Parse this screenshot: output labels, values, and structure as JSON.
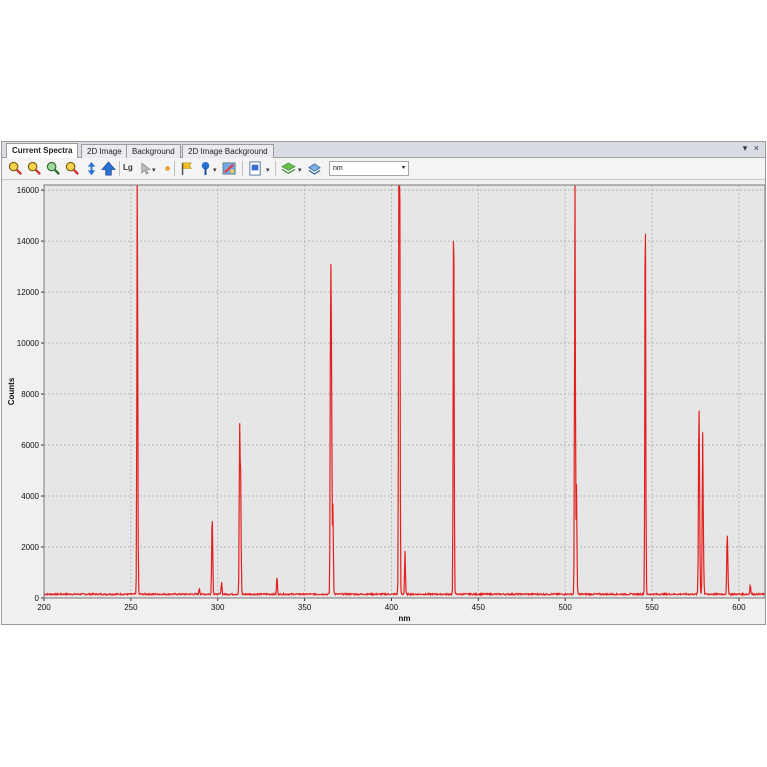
{
  "tabs": [
    {
      "label": "Current Spectra",
      "active": true
    },
    {
      "label": "2D Image",
      "active": false
    },
    {
      "label": "Background",
      "active": false
    },
    {
      "label": "2D Image Background",
      "active": false
    }
  ],
  "tab_menu": "▾ ×",
  "toolbar": {
    "log_label": "Lg",
    "unit_value": "nm",
    "icons": [
      "zoom-in-icon",
      "zoom-out-icon",
      "zoom-fit-icon",
      "zoom-reset-icon",
      "scale-vertical-icon",
      "arrow-up-icon",
      "cursor-icon",
      "dot-icon",
      "flag-icon",
      "pin-icon",
      "palette-icon",
      "save-icon",
      "layers-icon",
      "print-icon"
    ]
  },
  "colors": {
    "trace": "#e32020",
    "plot_bg": "#e6e6e6",
    "grid": "#b8b8b8"
  },
  "chart_data": {
    "type": "line",
    "xlabel": "nm",
    "ylabel": "Counts",
    "xlim": [
      200,
      615
    ],
    "ylim": [
      0,
      16200
    ],
    "x_ticks": [
      200,
      250,
      300,
      350,
      400,
      450,
      500,
      550,
      600
    ],
    "y_ticks": [
      0,
      2000,
      4000,
      6000,
      8000,
      10000,
      12000,
      14000,
      16000
    ],
    "grid": true,
    "series": [
      {
        "baseline": 150,
        "peaks": [
          {
            "x": 253.7,
            "y": 16200
          },
          {
            "x": 254.0,
            "y": 1100
          },
          {
            "x": 289.4,
            "y": 250
          },
          {
            "x": 296.7,
            "y": 2100
          },
          {
            "x": 297.0,
            "y": 1600
          },
          {
            "x": 302.2,
            "y": 500
          },
          {
            "x": 312.6,
            "y": 6400
          },
          {
            "x": 313.2,
            "y": 4700
          },
          {
            "x": 334.1,
            "y": 700
          },
          {
            "x": 365.0,
            "y": 11800
          },
          {
            "x": 365.5,
            "y": 7900
          },
          {
            "x": 366.3,
            "y": 3500
          },
          {
            "x": 404.7,
            "y": 16200
          },
          {
            "x": 404.3,
            "y": 14000
          },
          {
            "x": 407.8,
            "y": 1700
          },
          {
            "x": 435.8,
            "y": 16200
          },
          {
            "x": 505.6,
            "y": 16200
          },
          {
            "x": 506.5,
            "y": 4300
          },
          {
            "x": 546.1,
            "y": 16200
          },
          {
            "x": 576.9,
            "y": 6400
          },
          {
            "x": 577.3,
            "y": 3200
          },
          {
            "x": 579.1,
            "y": 6200
          },
          {
            "x": 579.6,
            "y": 1300
          },
          {
            "x": 593.2,
            "y": 2100
          },
          {
            "x": 593.6,
            "y": 900
          },
          {
            "x": 606.5,
            "y": 400
          }
        ]
      }
    ]
  }
}
